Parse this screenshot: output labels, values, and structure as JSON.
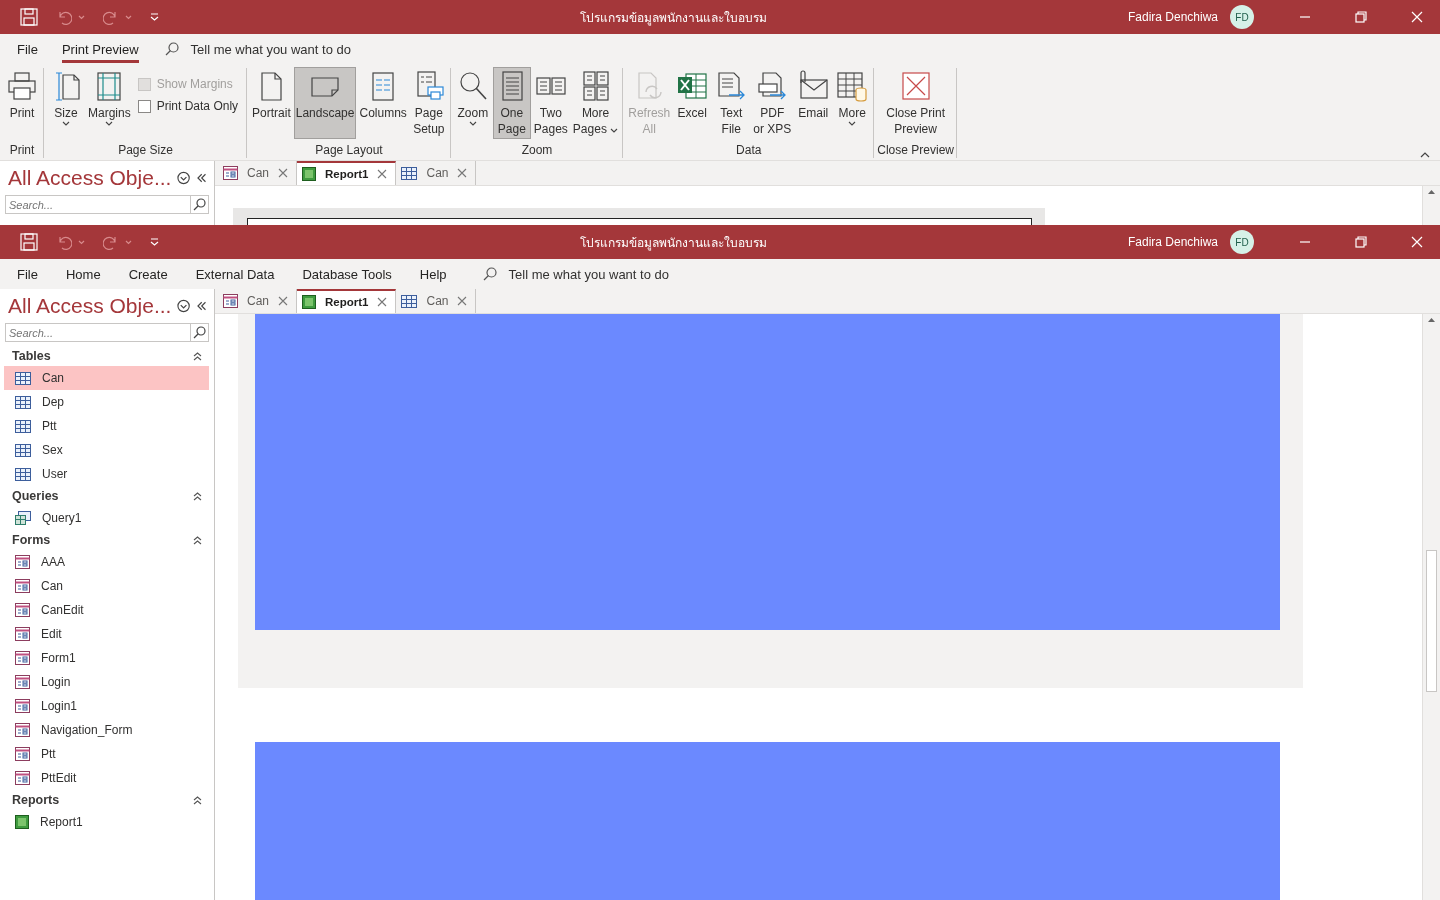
{
  "windows": [
    {
      "title": "โปรแกรมข้อมูลพนักงานและใบอบรม",
      "user": "Fadira Denchiwa",
      "avatar": "FD",
      "ribbon_tabs": [
        {
          "label": "File",
          "selected": false
        },
        {
          "label": "Print Preview",
          "selected": true
        }
      ],
      "tell_me": "Tell me what you want to do",
      "ribbon_groups": [
        {
          "label": "Print",
          "controls": [
            {
              "kind": "large",
              "label": "Print",
              "dropdown": false,
              "selected": false,
              "disabled": false
            }
          ]
        },
        {
          "label": "Page Size",
          "controls": [
            {
              "kind": "large",
              "label": "Size",
              "dropdown": true,
              "selected": false,
              "disabled": false
            },
            {
              "kind": "large",
              "label": "Margins",
              "dropdown": true,
              "selected": false,
              "disabled": false
            },
            {
              "kind": "checks",
              "items": [
                {
                  "label": "Show Margins",
                  "checked": false,
                  "disabled": true
                },
                {
                  "label": "Print Data Only",
                  "checked": false,
                  "disabled": false
                }
              ]
            }
          ]
        },
        {
          "label": "Page Layout",
          "controls": [
            {
              "kind": "large",
              "label": "Portrait",
              "dropdown": false,
              "selected": false,
              "disabled": false
            },
            {
              "kind": "large",
              "label": "Landscape",
              "dropdown": false,
              "selected": true,
              "disabled": false
            },
            {
              "kind": "large",
              "label": "Columns",
              "dropdown": false,
              "selected": false,
              "disabled": false
            },
            {
              "kind": "large",
              "label": "Page\nSetup",
              "dropdown": false,
              "selected": false,
              "disabled": false
            }
          ]
        },
        {
          "label": "Zoom",
          "controls": [
            {
              "kind": "large",
              "label": "Zoom",
              "dropdown": true,
              "selected": false,
              "disabled": false
            },
            {
              "kind": "large",
              "label": "One\nPage",
              "dropdown": false,
              "selected": true,
              "disabled": false
            },
            {
              "kind": "large",
              "label": "Two\nPages",
              "dropdown": false,
              "selected": false,
              "disabled": false
            },
            {
              "kind": "large",
              "label": "More\nPages",
              "dropdown": true,
              "selected": false,
              "disabled": false
            }
          ]
        },
        {
          "label": "Data",
          "controls": [
            {
              "kind": "large",
              "label": "Refresh\nAll",
              "dropdown": false,
              "selected": false,
              "disabled": true
            },
            {
              "kind": "large",
              "label": "Excel",
              "dropdown": false,
              "selected": false,
              "disabled": false
            },
            {
              "kind": "large",
              "label": "Text\nFile",
              "dropdown": false,
              "selected": false,
              "disabled": false
            },
            {
              "kind": "large",
              "label": "PDF\nor XPS",
              "dropdown": false,
              "selected": false,
              "disabled": false
            },
            {
              "kind": "large",
              "label": "Email",
              "dropdown": false,
              "selected": false,
              "disabled": false
            },
            {
              "kind": "large",
              "label": "More",
              "dropdown": true,
              "selected": false,
              "disabled": false
            }
          ]
        },
        {
          "label": "Close Preview",
          "controls": [
            {
              "kind": "large",
              "label": "Close Print\nPreview",
              "dropdown": false,
              "selected": false,
              "disabled": false
            }
          ]
        }
      ],
      "nav_pane": {
        "title": "All Access Obje...",
        "search_placeholder": "Search..."
      },
      "document_tabs": [
        {
          "label": "Can",
          "kind": "form",
          "selected": false
        },
        {
          "label": "Report1",
          "kind": "report",
          "selected": true
        },
        {
          "label": "Can",
          "kind": "table",
          "selected": false
        }
      ]
    },
    {
      "title": "โปรแกรมข้อมูลพนักงานและใบอบรม",
      "user": "Fadira Denchiwa",
      "avatar": "FD",
      "menu_tabs": [
        {
          "label": "File",
          "selected": false
        },
        {
          "label": "Home",
          "selected": false
        },
        {
          "label": "Create",
          "selected": false
        },
        {
          "label": "External Data",
          "selected": false
        },
        {
          "label": "Database Tools",
          "selected": false
        },
        {
          "label": "Help",
          "selected": false
        }
      ],
      "tell_me": "Tell me what you want to do",
      "nav_pane": {
        "title": "All Access Obje...",
        "search_placeholder": "Search...",
        "sections": [
          {
            "label": "Tables",
            "kind": "table",
            "expanded": true,
            "items": [
              {
                "label": "Can",
                "selected": true
              },
              {
                "label": "Dep",
                "selected": false
              },
              {
                "label": "Ptt",
                "selected": false
              },
              {
                "label": "Sex",
                "selected": false
              },
              {
                "label": "User",
                "selected": false
              }
            ]
          },
          {
            "label": "Queries",
            "kind": "query",
            "expanded": true,
            "items": [
              {
                "label": "Query1",
                "selected": false
              }
            ]
          },
          {
            "label": "Forms",
            "kind": "form",
            "expanded": true,
            "items": [
              {
                "label": "AAA",
                "selected": false
              },
              {
                "label": "Can",
                "selected": false
              },
              {
                "label": "CanEdit",
                "selected": false
              },
              {
                "label": "Edit",
                "selected": false
              },
              {
                "label": "Form1",
                "selected": false
              },
              {
                "label": "Login",
                "selected": false
              },
              {
                "label": "Login1",
                "selected": false
              },
              {
                "label": "Navigation_Form",
                "selected": false
              },
              {
                "label": "Ptt",
                "selected": false
              },
              {
                "label": "PttEdit",
                "selected": false
              }
            ]
          },
          {
            "label": "Reports",
            "kind": "report",
            "expanded": true,
            "items": [
              {
                "label": "Report1",
                "selected": false
              }
            ]
          }
        ]
      },
      "document_tabs": [
        {
          "label": "Can",
          "kind": "form",
          "selected": false
        },
        {
          "label": "Report1",
          "kind": "report",
          "selected": true
        },
        {
          "label": "Can",
          "kind": "table",
          "selected": false
        }
      ]
    }
  ]
}
